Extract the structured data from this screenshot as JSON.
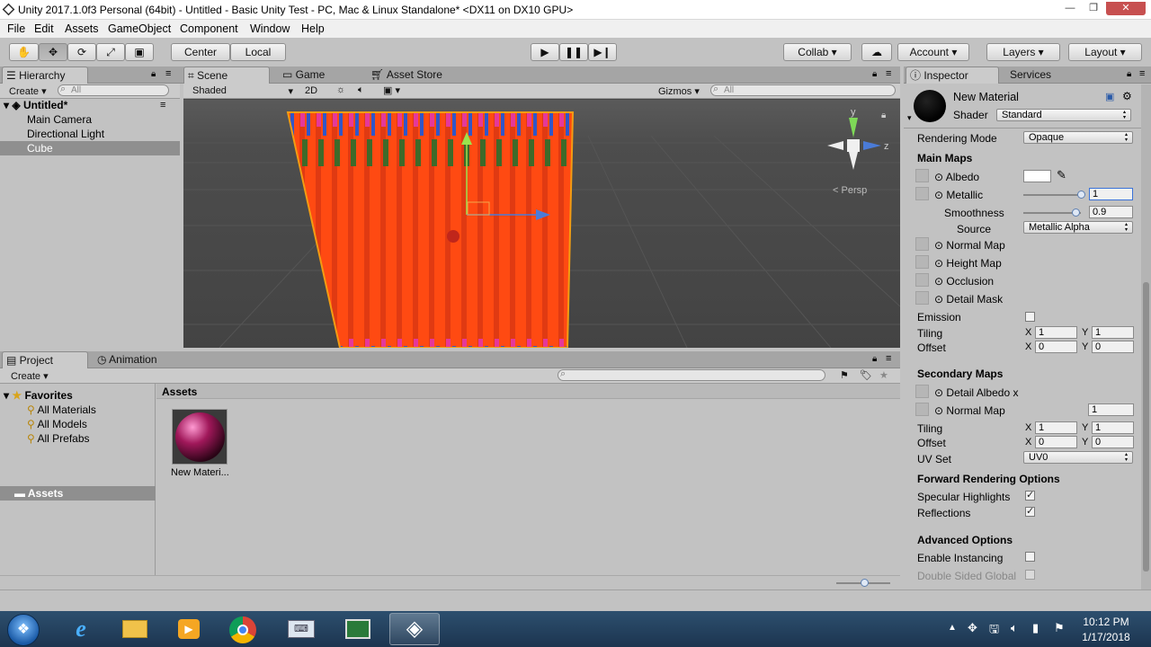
{
  "window": {
    "title": "Unity 2017.1.0f3 Personal (64bit) - Untitled - Basic Unity Test - PC, Mac & Linux Standalone* <DX11 on DX10 GPU>"
  },
  "menu": [
    "File",
    "Edit",
    "Assets",
    "GameObject",
    "Component",
    "Window",
    "Help"
  ],
  "toolbar": {
    "center": "Center",
    "local": "Local",
    "collab": "Collab",
    "account": "Account",
    "layers": "Layers",
    "layout": "Layout"
  },
  "hierarchy": {
    "tab": "Hierarchy",
    "create": "Create",
    "search_placeholder": "All",
    "scene_name": "Untitled*",
    "items": [
      "Main Camera",
      "Directional Light",
      "Cube"
    ]
  },
  "scene": {
    "tabs": [
      "Scene",
      "Game",
      "Asset Store"
    ],
    "shading": "Shaded",
    "mode2d": "2D",
    "gizmos": "Gizmos",
    "search_placeholder": "All",
    "persp": "Persp",
    "axis_y": "y",
    "axis_z": "z"
  },
  "project": {
    "tabs": [
      "Project",
      "Animation"
    ],
    "create": "Create",
    "favorites": "Favorites",
    "fav_items": [
      "All Materials",
      "All Models",
      "All Prefabs"
    ],
    "assets_folder": "Assets",
    "assets_header": "Assets",
    "asset_name": "New Materi..."
  },
  "inspector": {
    "tabs": [
      "Inspector",
      "Services"
    ],
    "name": "New Material",
    "shader_label": "Shader",
    "shader_value": "Standard",
    "rendering_mode_label": "Rendering Mode",
    "rendering_mode": "Opaque",
    "main_maps": "Main Maps",
    "albedo": "Albedo",
    "metallic": "Metallic",
    "metallic_value": "1",
    "metallic_level": 1,
    "smoothness": "Smoothness",
    "smoothness_value": "0.9",
    "smoothness_level": 0.9,
    "source_label": "Source",
    "source_value": "Metallic Alpha",
    "normal_map": "Normal Map",
    "height_map": "Height Map",
    "occlusion": "Occlusion",
    "detail_mask": "Detail Mask",
    "emission": "Emission",
    "tiling": "Tiling",
    "offset": "Offset",
    "x": "X",
    "y": "Y",
    "tiling_x": "1",
    "tiling_y": "1",
    "offset_x": "0",
    "offset_y": "0",
    "secondary_maps": "Secondary Maps",
    "detail_albedo": "Detail Albedo x",
    "normal_map2": "Normal Map",
    "normal_scale": "1",
    "tiling2_x": "1",
    "tiling2_y": "1",
    "offset2_x": "0",
    "offset2_y": "0",
    "uv_set_label": "UV Set",
    "uv_set": "UV0",
    "forward_opts": "Forward Rendering Options",
    "specular": "Specular Highlights",
    "reflections": "Reflections",
    "advanced": "Advanced Options",
    "instancing": "Enable Instancing",
    "double_sided": "Double Sided Global"
  },
  "taskbar": {
    "time": "10:12 PM",
    "date": "1/17/2018"
  },
  "colors": {
    "selection": "#3a72b0",
    "cube": "#e8421a",
    "outline": "#f39c12"
  }
}
